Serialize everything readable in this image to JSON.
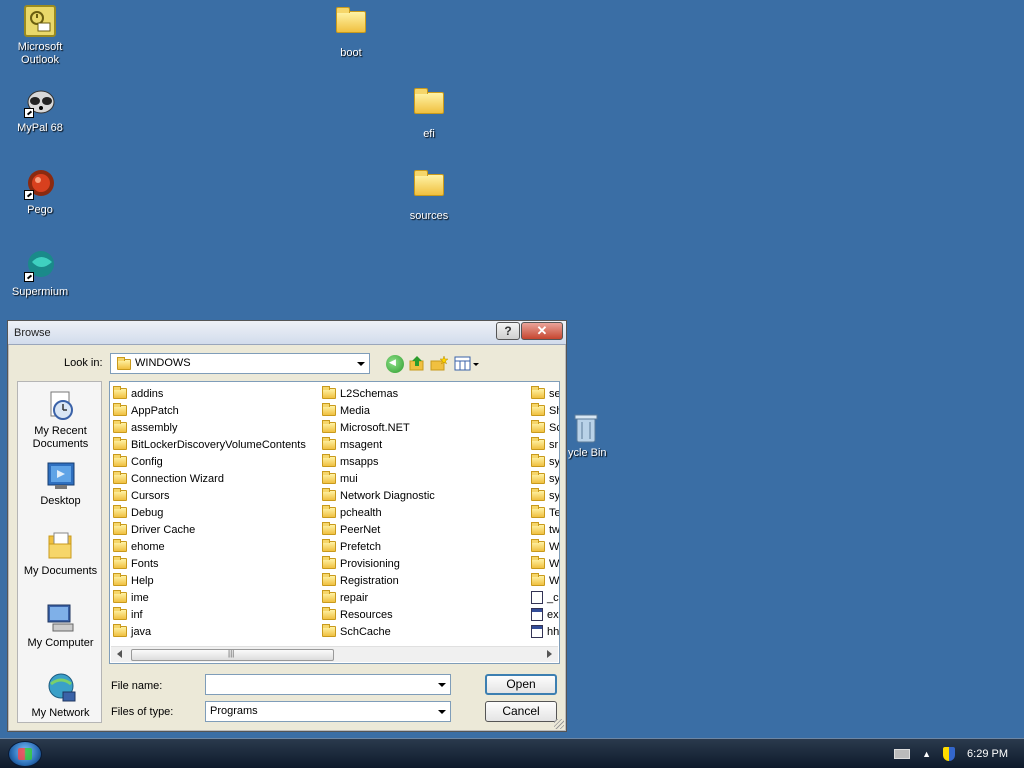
{
  "desktop": {
    "icons": [
      {
        "label": "Microsoft\nOutlook",
        "icon": "outlook-icon"
      },
      {
        "label": "MyPal 68",
        "icon": "mypal-icon"
      },
      {
        "label": "Pego",
        "icon": "pego-icon"
      },
      {
        "label": "Supermium",
        "icon": "supermium-icon"
      },
      {
        "label": "boot",
        "icon": "folder-icon"
      },
      {
        "label": "efi",
        "icon": "folder-icon"
      },
      {
        "label": "sources",
        "icon": "folder-icon"
      },
      {
        "label": "ycle Bin",
        "icon": "recycle-bin-icon"
      }
    ]
  },
  "dialog": {
    "title": "Browse",
    "help_label": "?",
    "close_label": "✕",
    "look_in_label": "Look in:",
    "look_in_value": "WINDOWS",
    "places": [
      {
        "label": "My Recent\nDocuments",
        "icon": "recent-documents-icon"
      },
      {
        "label": "Desktop",
        "icon": "desktop-icon"
      },
      {
        "label": "My Documents",
        "icon": "my-documents-icon"
      },
      {
        "label": "My Computer",
        "icon": "my-computer-icon"
      },
      {
        "label": "My Network",
        "icon": "my-network-icon"
      }
    ],
    "columns": [
      [
        "addins",
        "AppPatch",
        "assembly",
        "BitLockerDiscoveryVolumeContents",
        "Config",
        "Connection Wizard",
        "Cursors",
        "Debug",
        "Driver Cache",
        "ehome",
        "Fonts",
        "Help",
        "ime",
        "inf",
        "java"
      ],
      [
        "L2Schemas",
        "Media",
        "Microsoft.NET",
        "msagent",
        "msapps",
        "mui",
        "Network Diagnostic",
        "pchealth",
        "PeerNet",
        "Prefetch",
        "Provisioning",
        "Registration",
        "repair",
        "Resources",
        "SchCache"
      ],
      [
        "se",
        "Sh",
        "Sc",
        "sr",
        "sy",
        "sy",
        "sy",
        "Te",
        "tw",
        "W",
        "W",
        "W",
        "_c",
        "ex",
        "hh"
      ]
    ],
    "file_name_label": "File name:",
    "file_name_value": "",
    "files_of_type_label": "Files of type:",
    "files_of_type_value": "Programs",
    "open_label": "Open",
    "cancel_label": "Cancel"
  },
  "taskbar": {
    "clock": "6:29 PM"
  }
}
